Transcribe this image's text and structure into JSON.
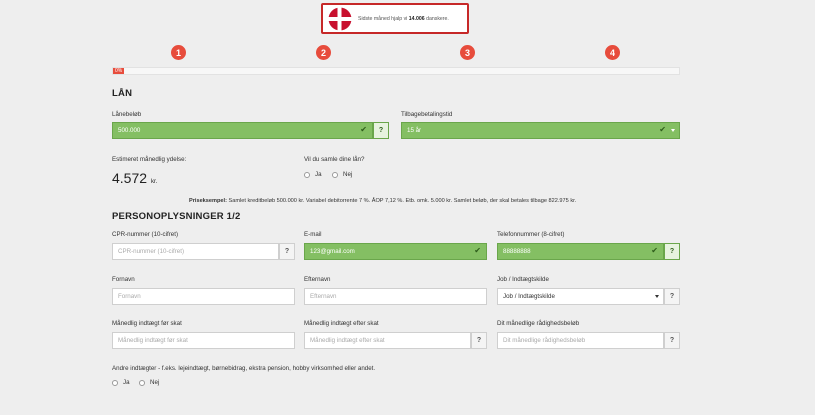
{
  "badge": {
    "text_pre": "Sidste måned hjalp vi ",
    "count": "14.006",
    "text_post": " danskere."
  },
  "steps": [
    "1",
    "2",
    "3",
    "4"
  ],
  "progress": {
    "label": "0%",
    "value": 0
  },
  "loan": {
    "heading": "LÅN",
    "amount_label": "Lånebeløb",
    "amount_value": "500.000",
    "term_label": "Tilbagebetalingstid",
    "term_value": "15 år",
    "monthly_label": "Estimeret månedlig ydelse:",
    "monthly_value": "4.572",
    "monthly_unit": "kr.",
    "consolidate_label": "Vil du samle dine lån?",
    "yes": "Ja",
    "no": "Nej"
  },
  "price_example": {
    "bold": "Priseksempel:",
    "text": " Samlet kreditbeløb 500.000 kr. Variabel debitorrente 7 %. ÅOP 7,12 %. Etb. omk. 5.000 kr. Samlet beløb, der skal betales tilbage 822.975 kr."
  },
  "personal": {
    "heading": "PERSONOPLYSNINGER 1/2",
    "cpr_label": "CPR-nummer (10-cifret)",
    "cpr_placeholder": "CPR-nummer (10-cifret)",
    "email_label": "E-mail",
    "email_value": "123@gmail.com",
    "phone_label": "Telefonnummer (8-cifret)",
    "phone_value": "88888888",
    "first_label": "Fornavn",
    "first_placeholder": "Fornavn",
    "last_label": "Efternavn",
    "last_placeholder": "Efternavn",
    "job_label": "Job / Indtægtskilde",
    "job_value": "Job / Indtægtskilde",
    "income_before_label": "Månedlig indtægt før skat",
    "income_before_placeholder": "Månedlig indtægt før skat",
    "income_after_label": "Månedlig indtægt efter skat",
    "income_after_placeholder": "Månedlig indtægt efter skat",
    "disposable_label": "Dit månedlige rådighedsbeløb",
    "disposable_placeholder": "Dit månedlige rådighedsbeløb",
    "other_income_label": "Andre indtægter - f.eks. lejeindtægt, børnebidrag, ekstra pension, hobby virksomhed eller andet.",
    "yes": "Ja",
    "no": "Nej"
  },
  "help_symbol": "?",
  "check_symbol": "✔",
  "colors": {
    "accent": "#e74c3c",
    "valid": "#84bf63",
    "badge_border": "#c62828"
  }
}
